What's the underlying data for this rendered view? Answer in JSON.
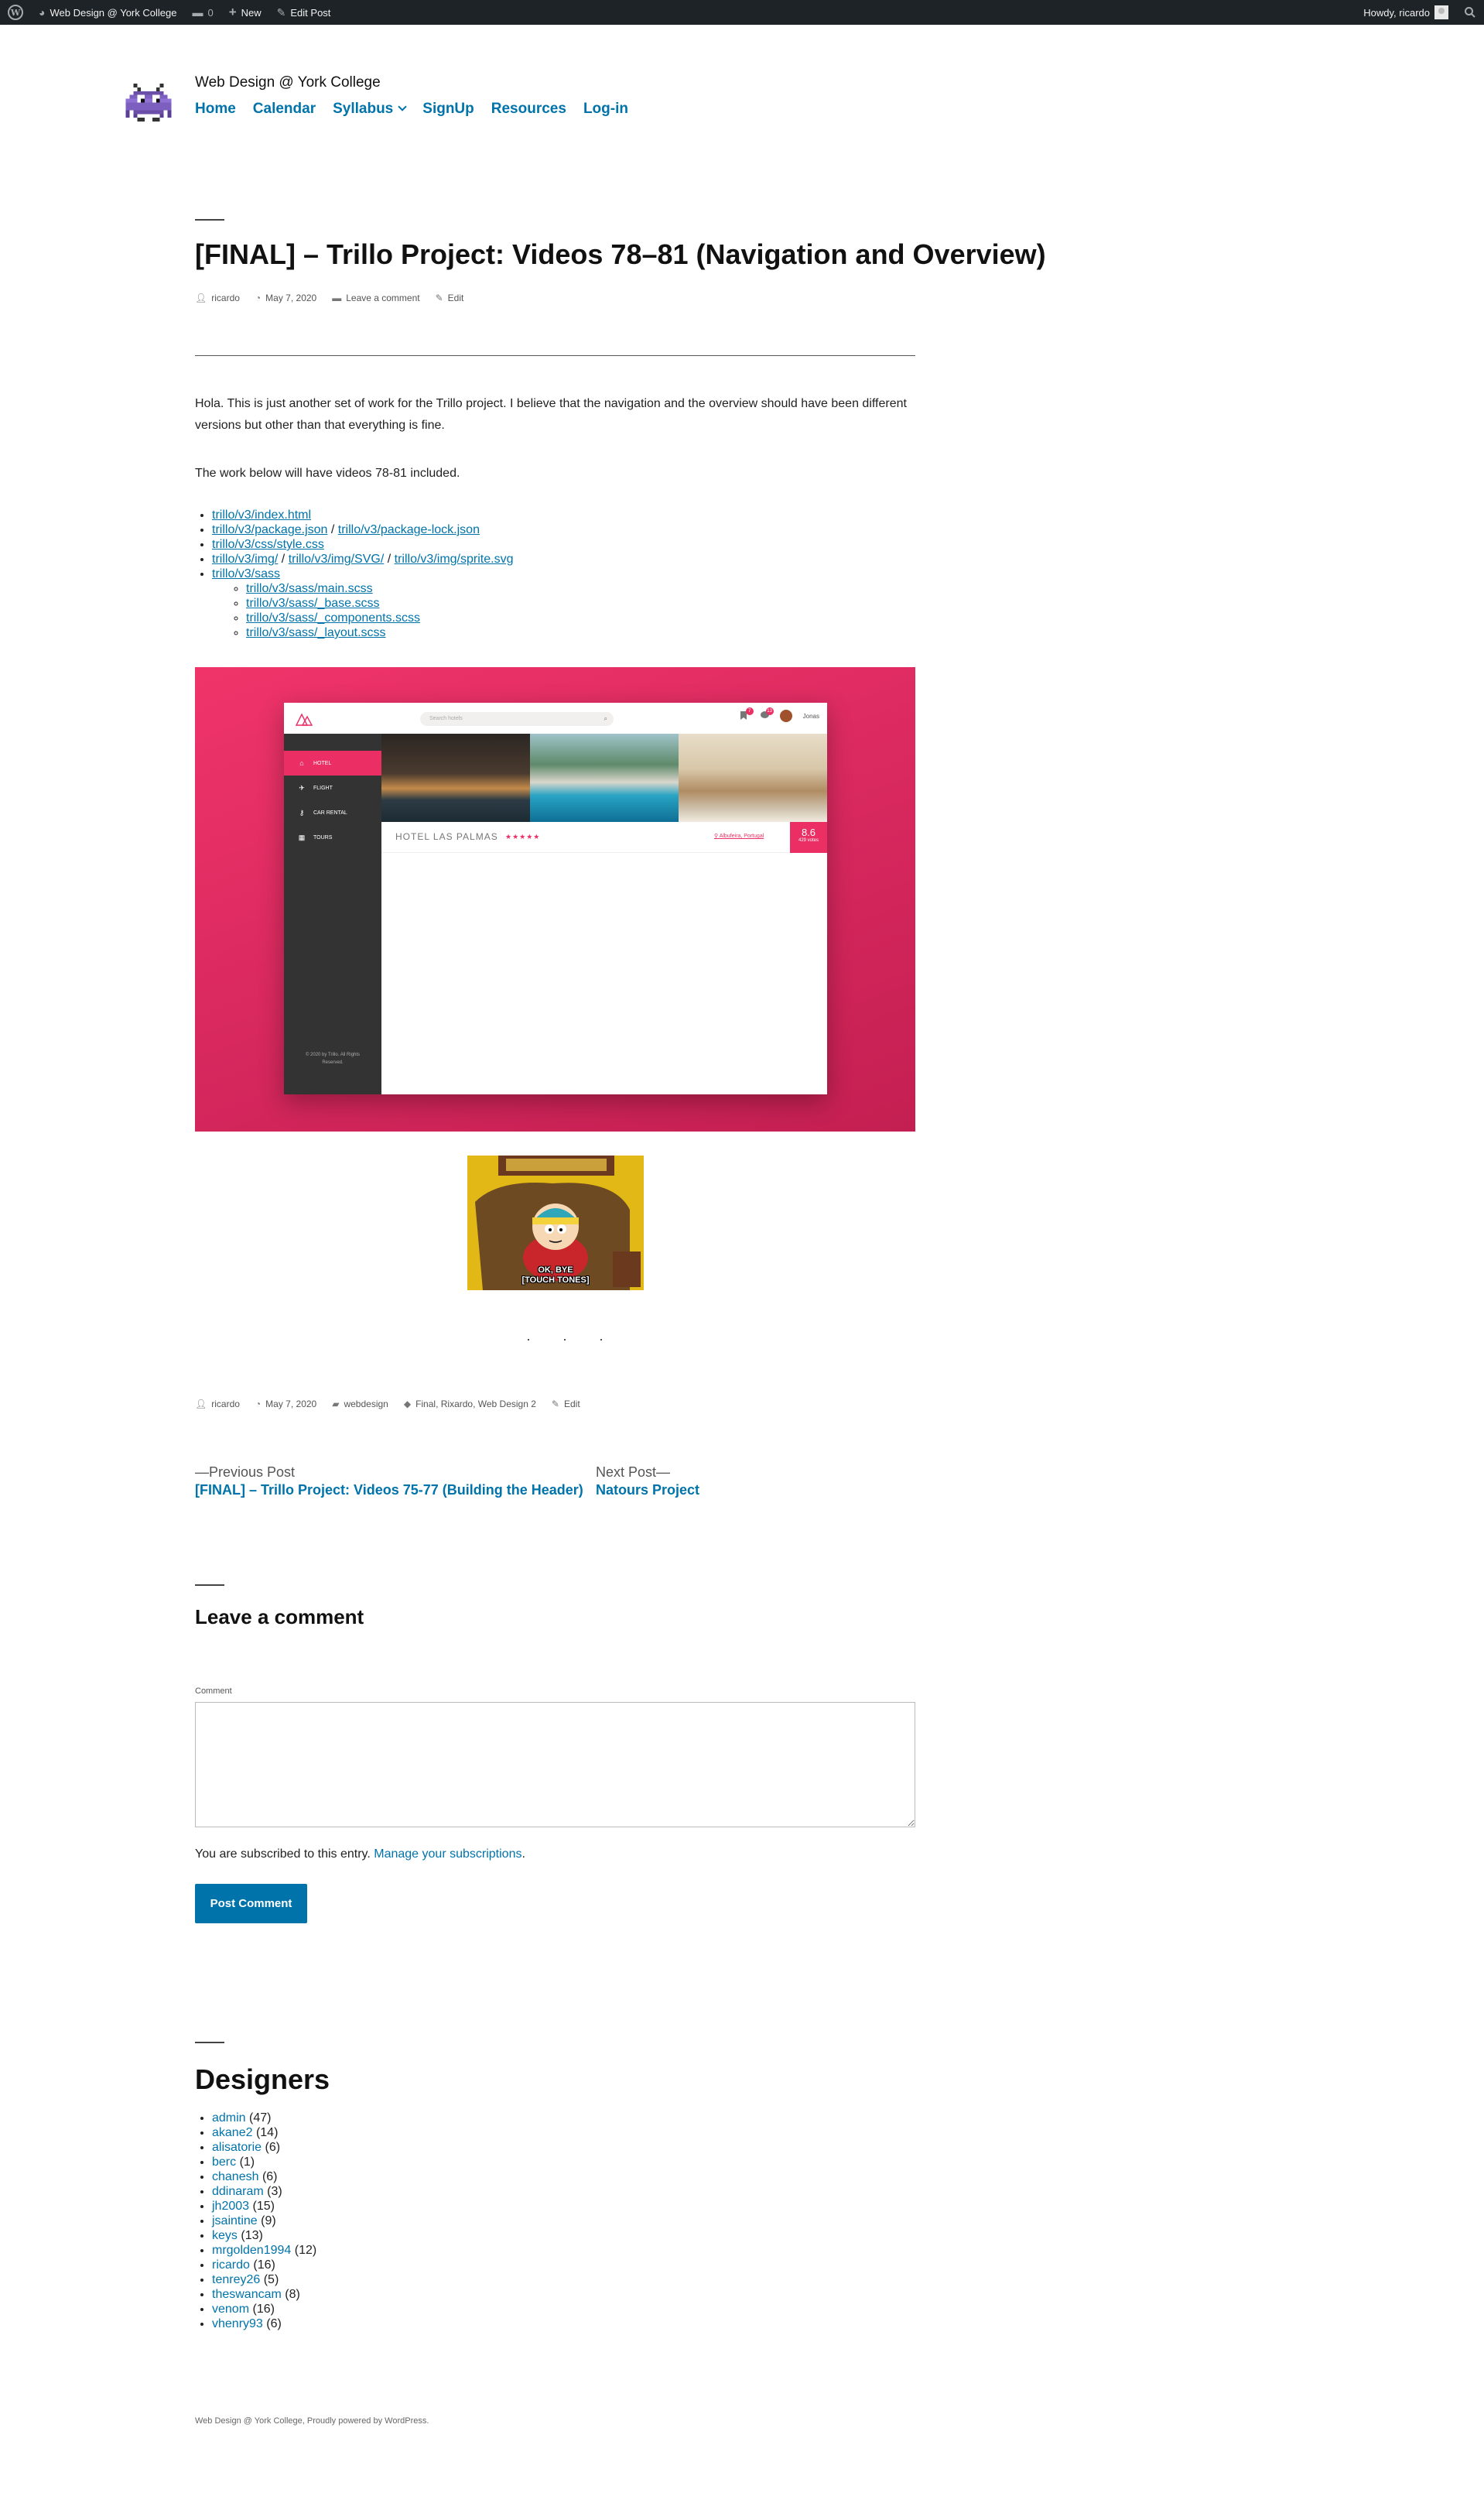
{
  "admin_bar": {
    "site_name": "Web Design @ York College",
    "comments_count": "0",
    "new_label": "New",
    "edit_post_label": "Edit Post",
    "howdy": "Howdy, ricardo"
  },
  "header": {
    "site_title": "Web Design @ York College",
    "nav": [
      "Home",
      "Calendar",
      "Syllabus",
      "SignUp",
      "Resources",
      "Log-in"
    ]
  },
  "post": {
    "title": "[FINAL] – Trillo Project: Videos 78–81 (Navigation and Overview)",
    "meta": {
      "author": "ricardo",
      "date": "May 7, 2020",
      "comment_link": "Leave a comment",
      "edit": "Edit"
    },
    "intro": "Hola. This is just another set of work for the Trillo project. I believe that the navigation and the overview should have been different versions but other than that everything is fine.",
    "videos_note": "The work below will have videos 78-81 included.",
    "files": {
      "index": "trillo/v3/index.html",
      "package": "trillo/v3/package.json",
      "package_lock": "trillo/v3/package-lock.json",
      "css": "trillo/v3/css/style.css",
      "img": "trillo/v3/img/",
      "svg": "trillo/v3/img/SVG/",
      "sprite": "trillo/v3/img/sprite.svg",
      "sass": "trillo/v3/sass",
      "sass_files": [
        "trillo/v3/sass/main.scss",
        "trillo/v3/sass/_base.scss",
        "trillo/v3/sass/_components.scss",
        "trillo/v3/sass/_layout.scss"
      ]
    },
    "footer_meta": {
      "author": "ricardo",
      "date": "May 7, 2020",
      "category": "webdesign",
      "tags": "Final, Rixardo, Web Design 2",
      "edit": "Edit"
    }
  },
  "trillo_preview": {
    "search_placeholder": "Search hotels",
    "notif_count_1": "7",
    "notif_count_2": "13",
    "user_name": "Jonas",
    "sidebar": [
      "HOTEL",
      "FLIGHT",
      "CAR RENTAL",
      "TOURS"
    ],
    "sidebar_footer": "© 2020 by Trillo. All Rights Reserved.",
    "hotel_name": "HOTEL LAS PALMAS",
    "stars": "★★★★★",
    "location": "Albufeira, Portugal",
    "rating_value": "8.6",
    "rating_count": "429 votes",
    "colors": {
      "accent": "#eb2f64",
      "sidebar_bg": "#333333"
    }
  },
  "gif": {
    "caption_line1": "OK, BYE",
    "caption_line2": "[TOUCH TONES]"
  },
  "separator": "· · ·",
  "post_nav": {
    "prev_label": "—Previous Post",
    "prev_title": "[FINAL] – Trillo Project: Videos 75-77 (Building the Header)",
    "next_label": "Next Post—",
    "next_title": "Natours Project"
  },
  "comments": {
    "title": "Leave a comment",
    "field_label": "Comment",
    "subscribed_text": "You are subscribed to this entry.",
    "manage_link": "Manage your subscriptions",
    "submit_label": "Post Comment"
  },
  "designers": {
    "title": "Designers",
    "list": [
      {
        "name": "admin",
        "count": "(47)"
      },
      {
        "name": "akane2",
        "count": "(14)"
      },
      {
        "name": "alisatorie",
        "count": "(6)"
      },
      {
        "name": "berc",
        "count": "(1)"
      },
      {
        "name": "chanesh",
        "count": "(6)"
      },
      {
        "name": "ddinaram",
        "count": "(3)"
      },
      {
        "name": "jh2003",
        "count": "(15)"
      },
      {
        "name": "jsaintine",
        "count": "(9)"
      },
      {
        "name": "keys",
        "count": "(13)"
      },
      {
        "name": "mrgolden1994",
        "count": "(12)"
      },
      {
        "name": "ricardo",
        "count": "(16)"
      },
      {
        "name": "tenrey26",
        "count": "(5)"
      },
      {
        "name": "theswancam",
        "count": "(8)"
      },
      {
        "name": "venom",
        "count": "(16)"
      },
      {
        "name": "vhenry93",
        "count": "(6)"
      }
    ]
  },
  "footer": {
    "text": "Web Design @ York College, Proudly powered by WordPress."
  },
  "colors": {
    "link": "#0073aa",
    "admin_bar": "#1d2327"
  }
}
